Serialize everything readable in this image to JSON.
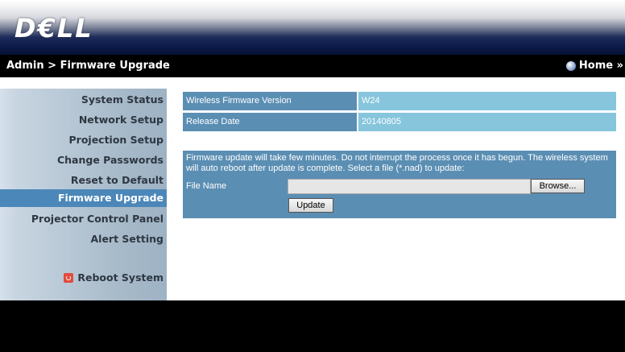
{
  "header": {
    "logo_text": "D€LL"
  },
  "navbar": {
    "breadcrumb": "Admin > Firmware Upgrade",
    "home_label": "Home »"
  },
  "sidebar": {
    "items": [
      {
        "label": "System Status"
      },
      {
        "label": "Network Setup"
      },
      {
        "label": "Projection Setup"
      },
      {
        "label": "Change Passwords"
      },
      {
        "label": "Reset to Default"
      },
      {
        "label": "Firmware Upgrade",
        "active": true
      },
      {
        "label": "Projector Control Panel"
      },
      {
        "label": "Alert Setting"
      }
    ],
    "reboot_label": "Reboot System"
  },
  "firmware": {
    "version_label": "Wireless Firmware Version",
    "version_value": "W24",
    "release_label": "Release Date",
    "release_value": "20140805",
    "note": "Firmware update will take few minutes. Do not interrupt the process once it has begun. The wireless system will auto reboot after update is complete. Select a file (*.nad) to update:",
    "file_label": "File Name",
    "file_value": "",
    "browse_label": "Browse...",
    "update_label": "Update"
  },
  "colors": {
    "active_item": "#4b87b8",
    "label_cell": "#5b8eb3",
    "value_cell": "#86c5dc",
    "reboot_icon": "#e24b3c"
  }
}
